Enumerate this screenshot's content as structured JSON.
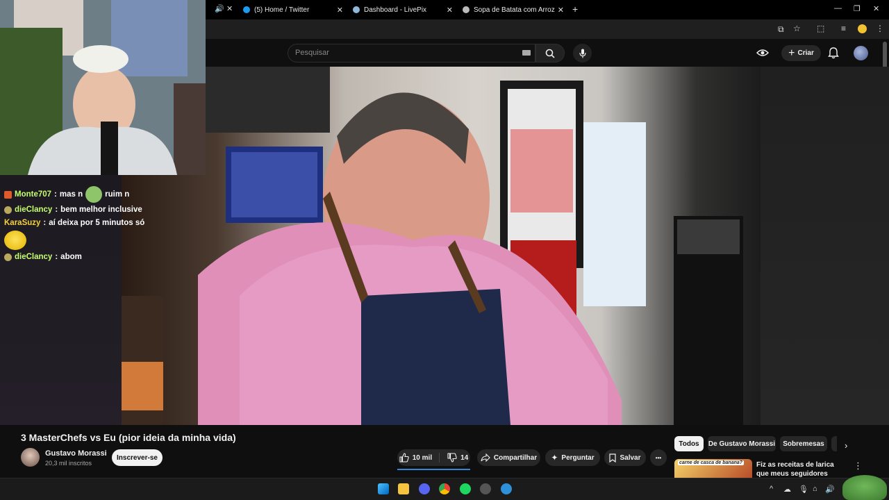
{
  "browser": {
    "tabs": [
      {
        "label": "(5) Home / Twitter"
      },
      {
        "label": "Dashboard - LivePix"
      },
      {
        "label": "Sopa de Batata com Arroz"
      }
    ],
    "new_tab": "+",
    "close": "✕"
  },
  "youtube": {
    "search_placeholder": "Pesquisar",
    "create_label": "Criar"
  },
  "chat": {
    "messages": [
      {
        "user": "Monte707",
        "text": "mas n",
        "extra": "ruim n",
        "color": "#c6ff6e"
      },
      {
        "user": "dieClancy",
        "text": "bem melhor inclusive",
        "color": "#c6ff6e"
      },
      {
        "user": "KaraSuzy",
        "text": "aí deixa por 5 minutos só",
        "color": "#f5d23c"
      },
      {
        "user": "dieClancy",
        "text": "abom",
        "color": "#c6ff6e"
      }
    ]
  },
  "video": {
    "title": "3 MasterChefs vs Eu (pior ideia da minha vida)",
    "channel": "Gustavo Morassi",
    "subscribers": "20,3 mil inscritos",
    "subscribe_label": "Inscrever-se",
    "likes": "10 mil",
    "dislikes": "14",
    "share_label": "Compartilhar",
    "ask_label": "Perguntar",
    "save_label": "Salvar",
    "more_label": "•••"
  },
  "filters": {
    "chips": [
      "Todos",
      "De Gustavo Morassi",
      "Sobremesas"
    ],
    "next": "›"
  },
  "recommendation": {
    "thumb_caption": "carne de casca de banana?",
    "title": "Fiz as receitas de larica que meus seguidores enviaram"
  },
  "colors": {
    "accent_blue": "#3ea6ff",
    "background": "#0f0f0f",
    "pill": "#272727"
  }
}
